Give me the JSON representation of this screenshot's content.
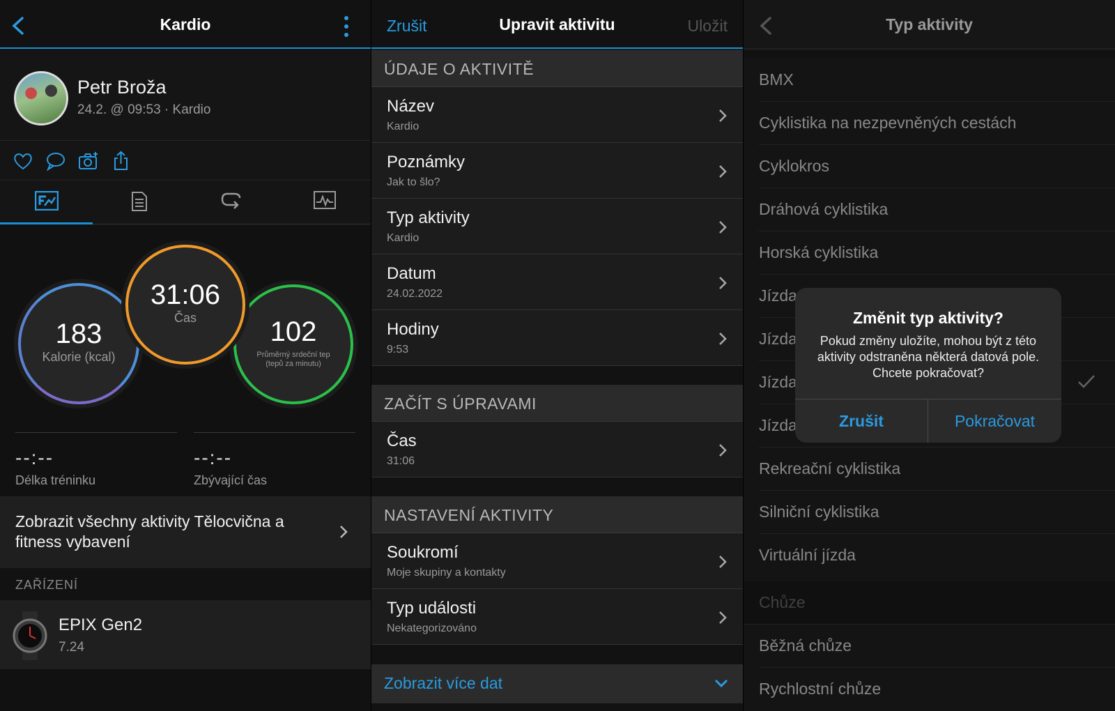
{
  "screen1": {
    "title": "Kardio",
    "profile": {
      "name": "Petr Broža",
      "subtitle": "24.2. @ 09:53 · Kardio"
    },
    "stats": {
      "calories": {
        "value": "183",
        "label": "Kalorie (kcal)"
      },
      "time": {
        "value": "31:06",
        "label": "Čas"
      },
      "heart_rate": {
        "value": "102",
        "label": "Průměrný srdeční tep (tepů za minutu)"
      }
    },
    "training_length": {
      "value": "--:--",
      "label": "Délka tréninku"
    },
    "remaining_time": {
      "value": "--:--",
      "label": "Zbývající čas"
    },
    "link": "Zobrazit všechny aktivity Tělocvična a fitness vybavení",
    "devices_header": "ZAŘÍZENÍ",
    "device": {
      "name": "EPIX Gen2",
      "version": "7.24"
    }
  },
  "screen2": {
    "cancel": "Zrušit",
    "title": "Upravit aktivitu",
    "save": "Uložit",
    "section1": "ÚDAJE O AKTIVITĚ",
    "rows1": [
      {
        "title": "Název",
        "value": "Kardio"
      },
      {
        "title": "Poznámky",
        "value": "Jak to šlo?"
      },
      {
        "title": "Typ aktivity",
        "value": "Kardio"
      },
      {
        "title": "Datum",
        "value": "24.02.2022"
      },
      {
        "title": "Hodiny",
        "value": "9:53"
      }
    ],
    "section2": "ZAČÍT S ÚPRAVAMI",
    "rows2": [
      {
        "title": "Čas",
        "value": "31:06"
      }
    ],
    "section3": "NASTAVENÍ AKTIVITY",
    "rows3": [
      {
        "title": "Soukromí",
        "value": "Moje skupiny a kontakty"
      },
      {
        "title": "Typ události",
        "value": "Nekategorizováno"
      }
    ],
    "more": "Zobrazit více dat"
  },
  "screen3": {
    "title": "Typ aktivity",
    "items": [
      "BMX",
      "Cyklistika na nezpevněných cestách",
      "Cyklokros",
      "Dráhová cyklistika",
      "Horská cyklistika",
      "Jízda",
      "Jízda",
      "Jízda",
      "Jízda",
      "Rekreační cyklistika",
      "Silniční cyklistika",
      "Virtuální jízda"
    ],
    "section_walk": "Chůze",
    "walk_items": [
      "Běžná chůze",
      "Rychlostní chůze"
    ],
    "dialog": {
      "title": "Změnit typ aktivity?",
      "message": "Pokud změny uložíte, mohou být z této aktivity odstraněna některá datová pole. Chcete pokračovat?",
      "cancel": "Zrušit",
      "continue": "Pokračovat"
    }
  },
  "colors": {
    "accent": "#1a8fd6",
    "calories_ring": "#4d8fd8",
    "time_ring": "#f09a2b",
    "hr_ring": "#2ac04a"
  }
}
